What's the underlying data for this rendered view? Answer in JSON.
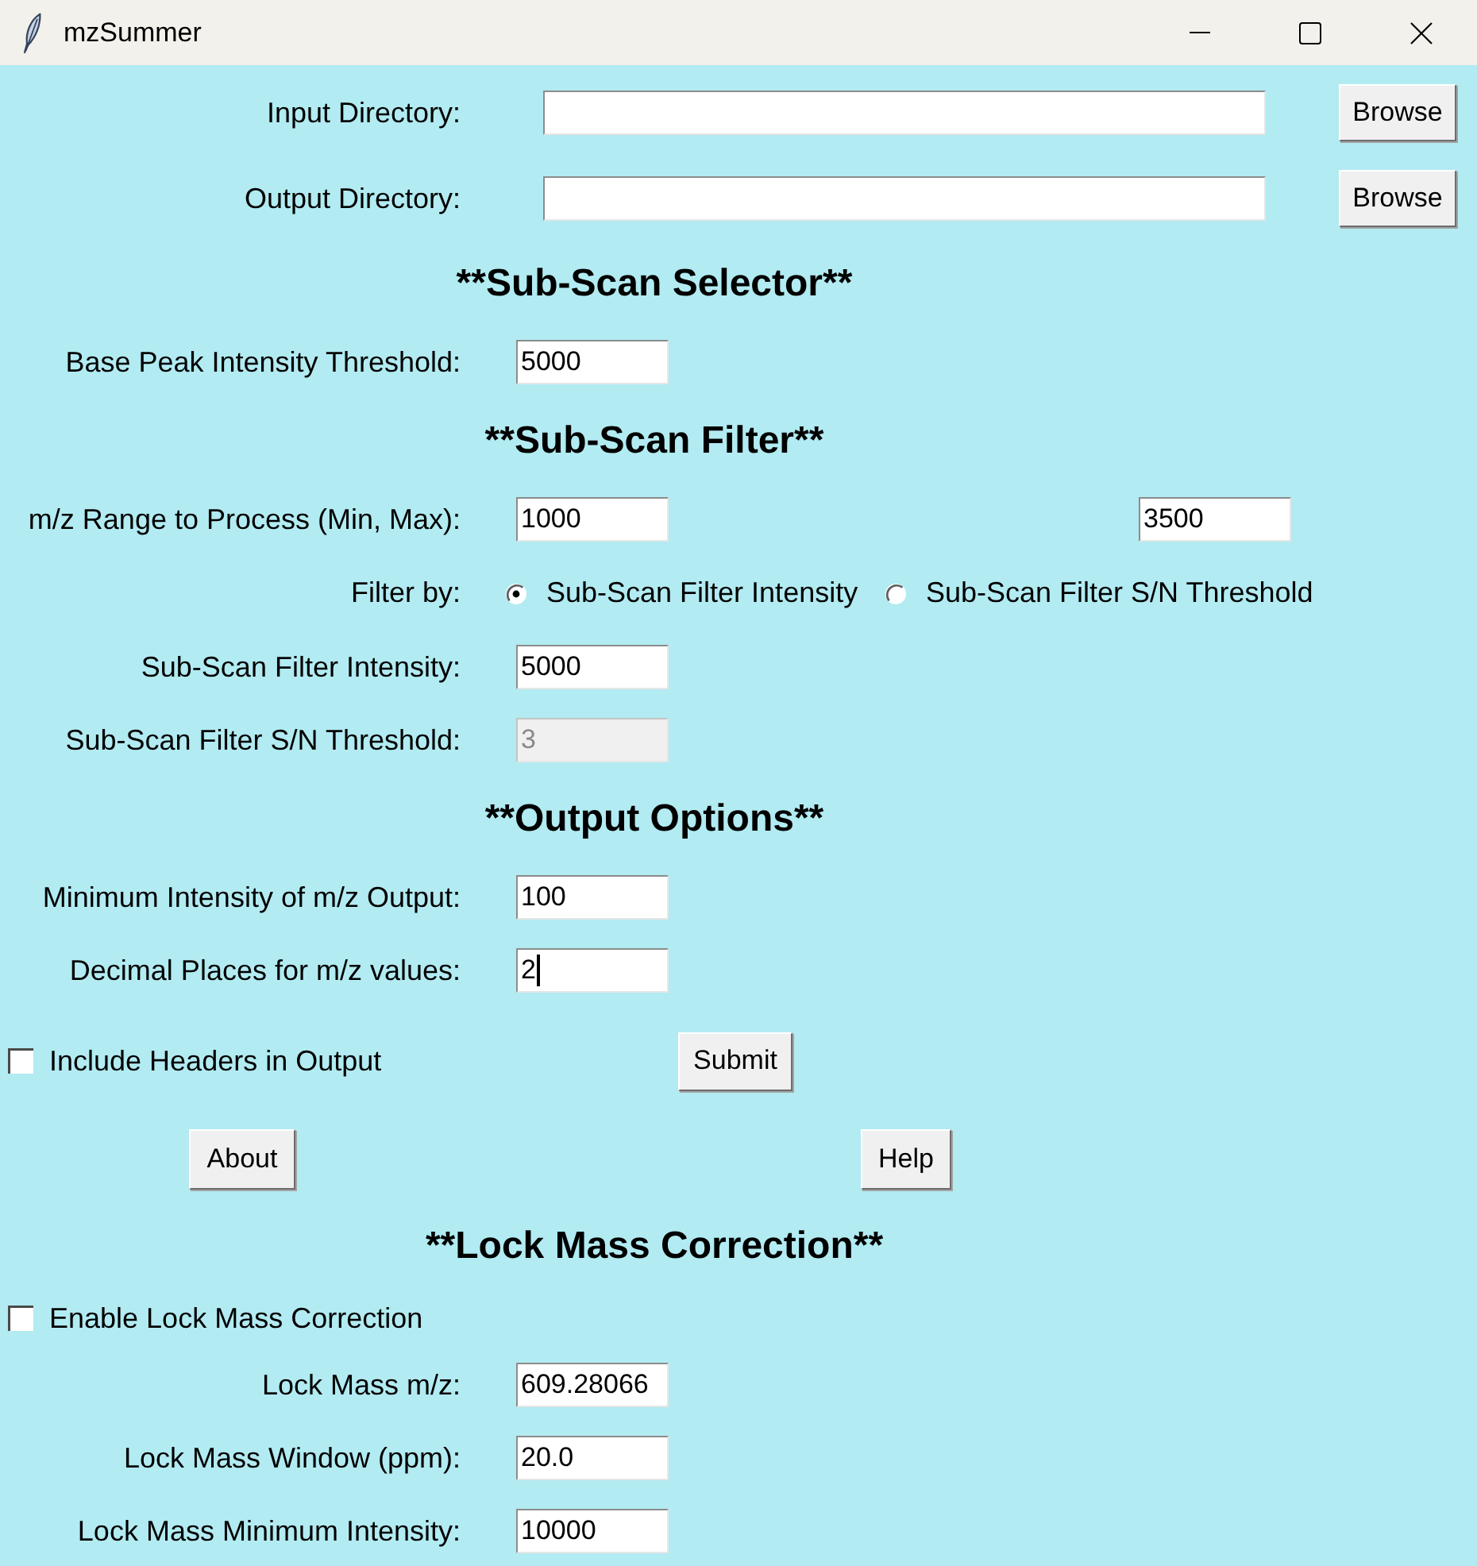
{
  "window": {
    "title": "mzSummer"
  },
  "rows": [
    {
      "kind": "directory",
      "label": "Input Directory:",
      "button": "Browse"
    },
    {
      "kind": "directory",
      "label": "Output Directory:",
      "button": "Browse"
    },
    {
      "kind": "heading",
      "text": "**Sub-Scan Selector**"
    },
    {
      "kind": "field",
      "label": "Base Peak Intensity Threshold:",
      "values": [
        "5000"
      ],
      "disabled": false,
      "focused": false
    },
    {
      "kind": "heading",
      "text": "**Sub-Scan Filter**"
    },
    {
      "kind": "field",
      "label": "m/z Range to Process (Min, Max):",
      "values": [
        "1000",
        "3500"
      ],
      "disabled": false,
      "focused": false
    },
    {
      "kind": "radio",
      "label": "Filter by:",
      "options": [
        {
          "label": "Sub-Scan Filter Intensity",
          "selected": true
        },
        {
          "label": "Sub-Scan Filter S/N Threshold",
          "selected": false
        }
      ]
    },
    {
      "kind": "field",
      "label": "Sub-Scan Filter Intensity:",
      "values": [
        "5000"
      ],
      "disabled": false,
      "focused": false
    },
    {
      "kind": "field",
      "label": "Sub-Scan Filter S/N Threshold:",
      "values": [
        "3"
      ],
      "disabled": true,
      "focused": false
    },
    {
      "kind": "heading",
      "text": "**Output Options**"
    },
    {
      "kind": "field",
      "label": "Minimum Intensity of m/z Output:",
      "values": [
        "100"
      ],
      "disabled": false,
      "focused": false
    },
    {
      "kind": "field",
      "label": "Decimal Places for m/z values:",
      "values": [
        "2"
      ],
      "disabled": false,
      "focused": true
    },
    {
      "kind": "checkbox",
      "label": "Include Headers in Output",
      "checked": false,
      "button": "Submit"
    },
    {
      "kind": "buttons",
      "buttons": [
        "About",
        "Help"
      ]
    },
    {
      "kind": "heading",
      "text": "**Lock Mass Correction**"
    },
    {
      "kind": "checkbox",
      "label": "Enable Lock Mass Correction",
      "checked": false
    },
    {
      "kind": "field",
      "label": "Lock Mass m/z:",
      "values": [
        "609.28066"
      ],
      "disabled": false,
      "focused": false
    },
    {
      "kind": "field",
      "label": "Lock Mass Window (ppm):",
      "values": [
        "20.0"
      ],
      "disabled": false,
      "focused": false
    },
    {
      "kind": "field",
      "label": "Lock Mass Minimum Intensity:",
      "values": [
        "10000"
      ],
      "disabled": false,
      "focused": false
    }
  ]
}
